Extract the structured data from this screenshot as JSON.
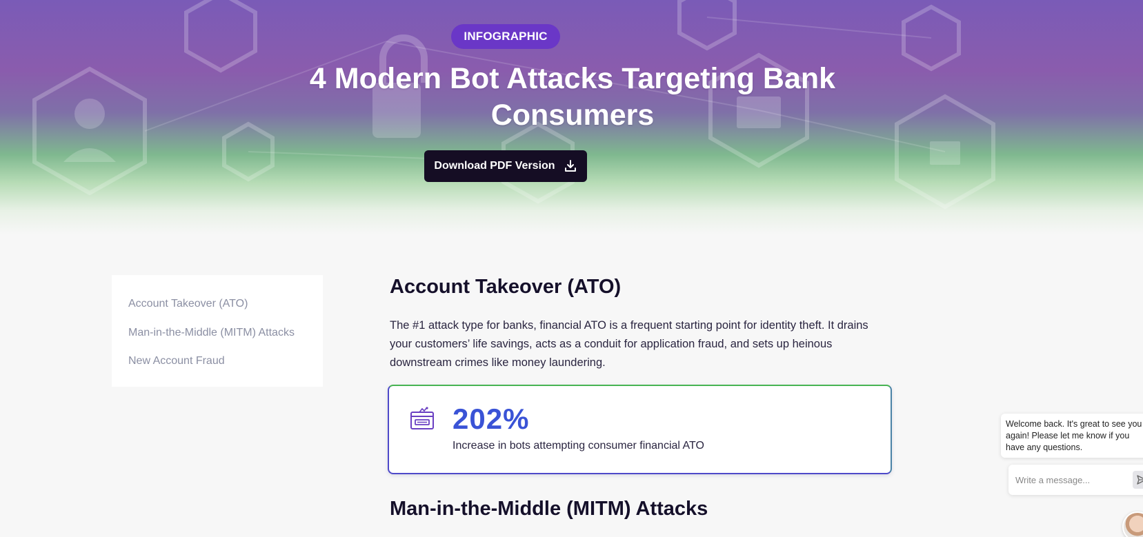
{
  "hero": {
    "badge": "INFOGRAPHIC",
    "title": "4 Modern Bot Attacks Targeting Bank Consumers",
    "download_label": "Download PDF Version"
  },
  "toc": {
    "items": [
      {
        "label": "Account Takeover (ATO)"
      },
      {
        "label": "Man-in-the-Middle (MITM) Attacks"
      },
      {
        "label": "New Account Fraud"
      }
    ]
  },
  "sections": [
    {
      "title": "Account Takeover (ATO)",
      "body": "The #1 attack type for banks, financial ATO is a frequent starting point for identity theft. It drains your customers’ life savings, acts as a conduit for application fraud, and sets up heinous downstream crimes like money laundering.",
      "stat": {
        "icon": "browser-bot-icon",
        "value": "202%",
        "description": "Increase in bots attempting consumer financial ATO"
      }
    },
    {
      "title": "Man-in-the-Middle (MITM) Attacks"
    }
  ],
  "chat": {
    "message_line1": "Welcome back. It's great to see you",
    "message_line2": "again! Please let me know if you",
    "message_line3": "have any questions.",
    "input_placeholder": "Write a message...",
    "send_icon": "send-icon",
    "avatar_icon": "agent-avatar"
  },
  "colors": {
    "badge": "#6a37c7",
    "button": "#150d24",
    "stat_value": "#3a53d6",
    "card_border_top": "#48b452",
    "card_border_bottom": "#4e49c9"
  }
}
